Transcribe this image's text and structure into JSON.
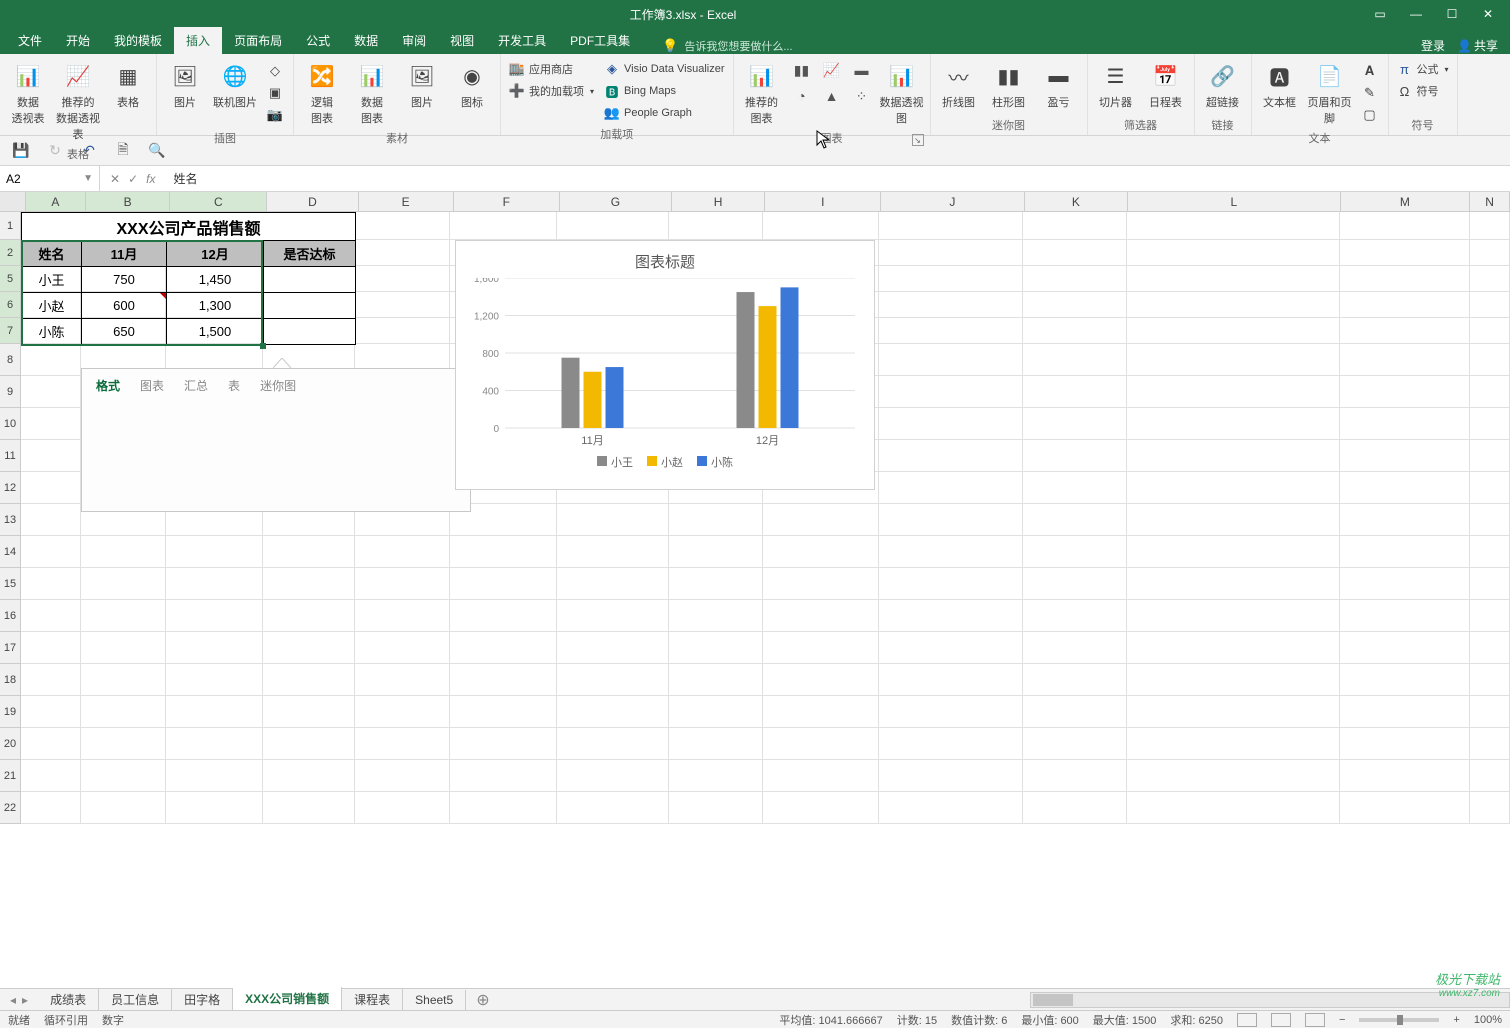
{
  "app": {
    "title": "工作簿3.xlsx - Excel"
  },
  "window_controls": {
    "ribbon_opts": "▭",
    "minimize": "—",
    "maximize": "☐",
    "close": "✕"
  },
  "menu_tabs": [
    "文件",
    "开始",
    "我的模板",
    "插入",
    "页面布局",
    "公式",
    "数据",
    "审阅",
    "视图",
    "开发工具",
    "PDF工具集"
  ],
  "active_menu_tab": 3,
  "tell_me": {
    "placeholder": "告诉我您想要做什么..."
  },
  "auth": {
    "login": "登录",
    "share": "共享"
  },
  "ribbon": {
    "g_tables": {
      "label": "表格",
      "pivot": "数据\n透视表",
      "rec_pivot": "推荐的\n数据透视表",
      "table": "表格"
    },
    "g_illus": {
      "label": "插图",
      "pic": "图片",
      "online_pic": "联机图片"
    },
    "g_material": {
      "label": "素材",
      "edit_pic": "逻辑\n图表",
      "data_pic": "数据\n图表",
      "picture": "图片",
      "icon": "图标"
    },
    "g_addins": {
      "label": "加载项",
      "store": "应用商店",
      "myaddins": "我的加载项",
      "visio": "Visio Data Visualizer",
      "bing": "Bing Maps",
      "people": "People Graph"
    },
    "g_charts": {
      "label": "图表",
      "rec_chart": "推荐的\n图表",
      "pivotchart": "数据透视图"
    },
    "g_spark": {
      "label": "迷你图",
      "line": "折线图",
      "col": "柱形图",
      "winloss": "盈亏"
    },
    "g_filter": {
      "label": "筛选器",
      "slicer": "切片器",
      "timeline": "日程表"
    },
    "g_links": {
      "label": "链接",
      "hyper": "超链接"
    },
    "g_text": {
      "label": "文本",
      "textbox": "文本框",
      "header": "页眉和页脚"
    },
    "g_symbols": {
      "label": "符号",
      "equation": "公式",
      "symbol": "符号"
    }
  },
  "namebox": "A2",
  "formula_value": "姓名",
  "columns": [
    "A",
    "B",
    "C",
    "D",
    "E",
    "F",
    "G",
    "H",
    "I",
    "J",
    "K",
    "L",
    "M",
    "N"
  ],
  "row_labels": [
    "1",
    "2",
    "5",
    "6",
    "7",
    "8",
    "9",
    "10",
    "11",
    "12",
    "13",
    "14",
    "15",
    "16",
    "17",
    "18",
    "19",
    "20",
    "21",
    "22"
  ],
  "table": {
    "title": "XXX公司产品销售额",
    "headers": [
      "姓名",
      "11月",
      "12月",
      "是否达标"
    ],
    "rows": [
      {
        "name": "小王",
        "nov": "750",
        "dec": "1,450",
        "pass": ""
      },
      {
        "name": "小赵",
        "nov": "600",
        "dec": "1,300",
        "pass": ""
      },
      {
        "name": "小陈",
        "nov": "650",
        "dec": "1,500",
        "pass": ""
      }
    ]
  },
  "quick_analysis": {
    "tabs": [
      "格式",
      "图表",
      "汇总",
      "表",
      "迷你图"
    ],
    "active": 0
  },
  "chart": {
    "title": "图表标题",
    "legend": [
      "小王",
      "小赵",
      "小陈"
    ],
    "colors": [
      "#8a8a8a",
      "#f2b900",
      "#3c78d8"
    ]
  },
  "chart_data": {
    "type": "bar",
    "categories": [
      "11月",
      "12月"
    ],
    "series": [
      {
        "name": "小王",
        "values": [
          750,
          1450
        ]
      },
      {
        "name": "小赵",
        "values": [
          600,
          1300
        ]
      },
      {
        "name": "小陈",
        "values": [
          650,
          1500
        ]
      }
    ],
    "title": "图表标题",
    "ylabel": "",
    "ylim": [
      0,
      1600
    ],
    "yticks": [
      0,
      400,
      800,
      1200,
      1600
    ]
  },
  "sheets": {
    "tabs": [
      "成绩表",
      "员工信息",
      "田字格",
      "XXX公司销售额",
      "课程表",
      "Sheet5"
    ],
    "active": 3
  },
  "status": {
    "ready": "就绪",
    "circ": "循环引用",
    "count_label": "数字",
    "avg": "平均值: 1041.666667",
    "count": "计数: 15",
    "numcount": "数值计数: 6",
    "min": "最小值: 600",
    "max": "最大值: 1500",
    "sum": "求和: 6250",
    "zoom": "100%"
  },
  "watermark": {
    "main": "极光下载站",
    "sub": "www.xz7.com"
  }
}
